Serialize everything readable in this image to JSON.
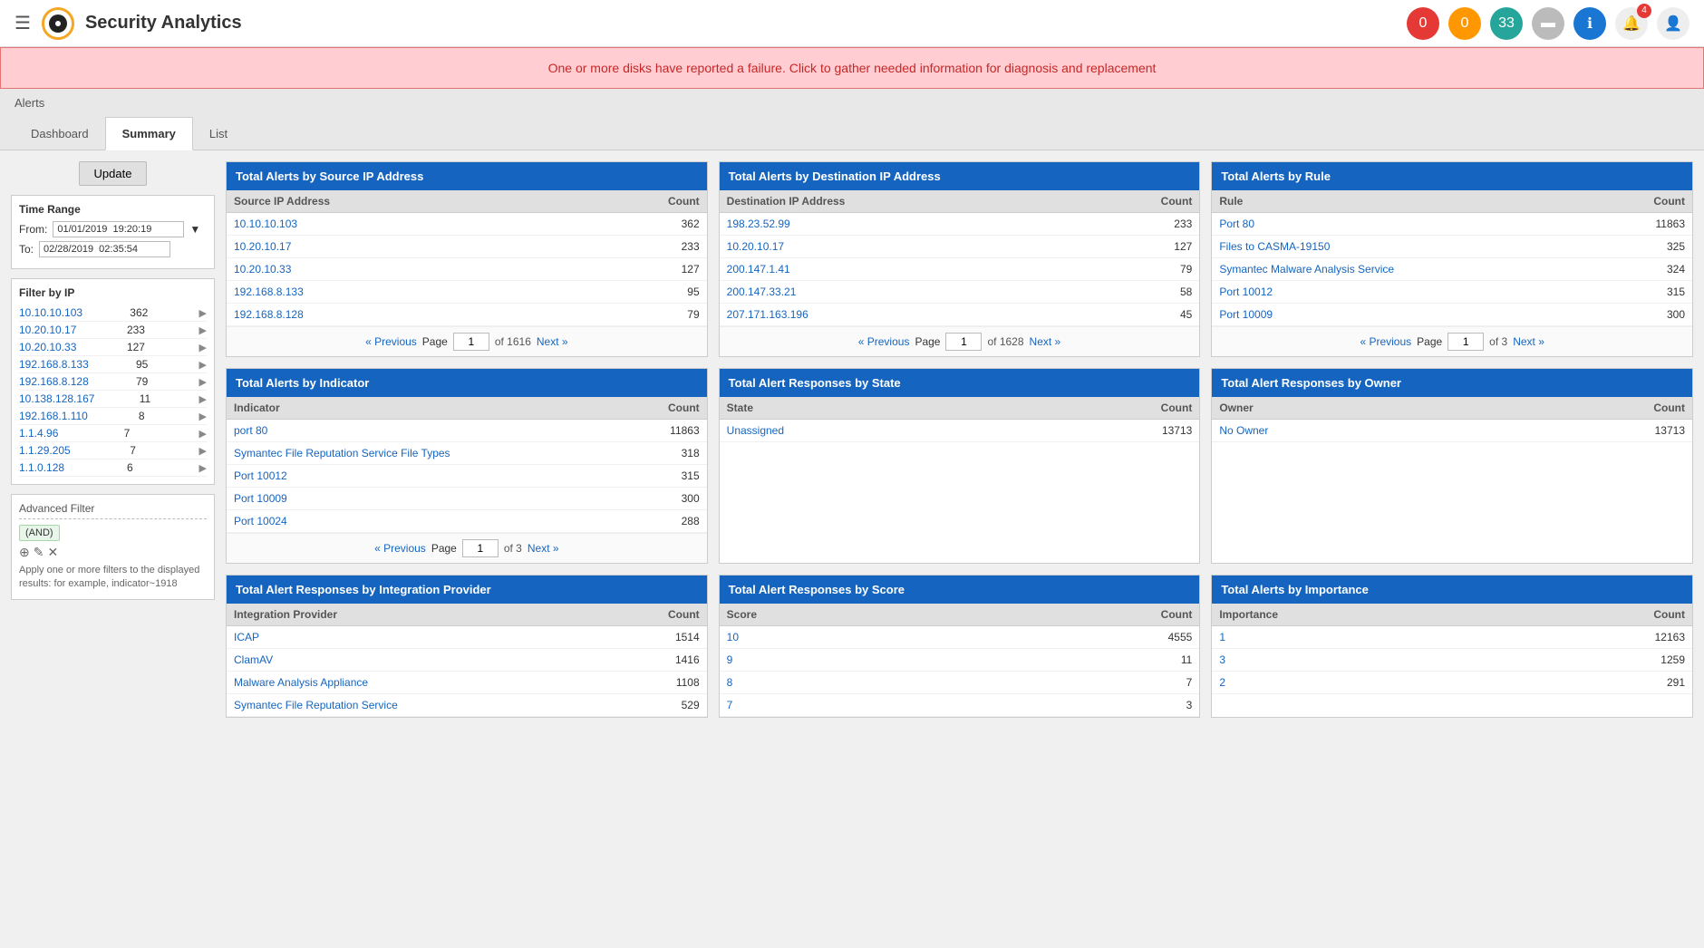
{
  "header": {
    "menu_icon": "☰",
    "logo_text": "●",
    "title": "Security Analytics",
    "badges": [
      {
        "id": "badge-0",
        "count": "0",
        "color": "red"
      },
      {
        "id": "badge-1",
        "count": "0",
        "color": "orange"
      },
      {
        "id": "badge-33",
        "count": "33",
        "color": "teal"
      }
    ],
    "notification_count": "4"
  },
  "alert_banner": "One or more disks have reported a failure. Click to gather needed information for diagnosis and replacement",
  "breadcrumb": "Alerts",
  "tabs": [
    {
      "label": "Dashboard",
      "active": false
    },
    {
      "label": "Summary",
      "active": true
    },
    {
      "label": "List",
      "active": false
    }
  ],
  "sidebar": {
    "update_btn": "Update",
    "time_range_title": "Time Range",
    "from_label": "From:",
    "from_value": "01/01/2019  19:20:19",
    "to_label": "To:",
    "to_value": "02/28/2019  02:35:54",
    "filter_by_ip_title": "Filter by IP",
    "ip_filters": [
      {
        "ip": "10.10.10.103",
        "count": "362"
      },
      {
        "ip": "10.20.10.17",
        "count": "233"
      },
      {
        "ip": "10.20.10.33",
        "count": "127"
      },
      {
        "ip": "192.168.8.133",
        "count": "95"
      },
      {
        "ip": "192.168.8.128",
        "count": "79"
      },
      {
        "ip": "10.138.128.167",
        "count": "11"
      },
      {
        "ip": "192.168.1.110",
        "count": "8"
      },
      {
        "ip": "1.1.4.96",
        "count": "7"
      },
      {
        "ip": "1.1.29.205",
        "count": "7"
      },
      {
        "ip": "1.1.0.128",
        "count": "6"
      }
    ],
    "advanced_filter_title": "Advanced Filter",
    "and_tag": "(AND)",
    "filter_help": "Apply one or more filters to the displayed results: for example, indicator~1918"
  },
  "cards": {
    "source_ip": {
      "title": "Total Alerts by Source IP Address",
      "col1": "Source IP Address",
      "col2": "Count",
      "rows": [
        {
          "label": "10.10.10.103",
          "count": "362"
        },
        {
          "label": "10.20.10.17",
          "count": "233"
        },
        {
          "label": "10.20.10.33",
          "count": "127"
        },
        {
          "label": "192.168.8.133",
          "count": "95"
        },
        {
          "label": "192.168.8.128",
          "count": "79"
        }
      ],
      "prev": "« Previous",
      "page": "1",
      "of": "of 1616",
      "next": "Next »"
    },
    "dest_ip": {
      "title": "Total Alerts by Destination IP Address",
      "col1": "Destination IP Address",
      "col2": "Count",
      "rows": [
        {
          "label": "198.23.52.99",
          "count": "233"
        },
        {
          "label": "10.20.10.17",
          "count": "127"
        },
        {
          "label": "200.147.1.41",
          "count": "79"
        },
        {
          "label": "200.147.33.21",
          "count": "58"
        },
        {
          "label": "207.171.163.196",
          "count": "45"
        }
      ],
      "prev": "« Previous",
      "page": "1",
      "of": "of 1628",
      "next": "Next »"
    },
    "rule": {
      "title": "Total Alerts by Rule",
      "col1": "Rule",
      "col2": "Count",
      "rows": [
        {
          "label": "Port 80",
          "count": "11863"
        },
        {
          "label": "Files to CASMA-19150",
          "count": "325"
        },
        {
          "label": "Symantec Malware Analysis Service",
          "count": "324"
        },
        {
          "label": "Port 10012",
          "count": "315"
        },
        {
          "label": "Port 10009",
          "count": "300"
        }
      ],
      "prev": "« Previous",
      "page": "1",
      "of": "of 3",
      "next": "Next »"
    },
    "indicator": {
      "title": "Total Alerts by Indicator",
      "col1": "Indicator",
      "col2": "Count",
      "rows": [
        {
          "label": "port 80",
          "count": "11863"
        },
        {
          "label": "Symantec File Reputation Service File Types",
          "count": "318"
        },
        {
          "label": "Port 10012",
          "count": "315"
        },
        {
          "label": "Port 10009",
          "count": "300"
        },
        {
          "label": "Port 10024",
          "count": "288"
        }
      ],
      "prev": "« Previous",
      "page": "1",
      "of": "of 3",
      "next": "Next »"
    },
    "response_state": {
      "title": "Total Alert Responses by State",
      "col1": "State",
      "col2": "Count",
      "rows": [
        {
          "label": "Unassigned",
          "count": "13713"
        }
      ]
    },
    "response_owner": {
      "title": "Total Alert Responses by Owner",
      "col1": "Owner",
      "col2": "Count",
      "rows": [
        {
          "label": "No Owner",
          "count": "13713"
        }
      ]
    },
    "integration_provider": {
      "title": "Total Alert Responses by Integration Provider",
      "col1": "Integration Provider",
      "col2": "Count",
      "rows": [
        {
          "label": "ICAP",
          "count": "1514"
        },
        {
          "label": "ClamAV",
          "count": "1416"
        },
        {
          "label": "Malware Analysis Appliance",
          "count": "1108"
        },
        {
          "label": "Symantec File Reputation Service",
          "count": "529"
        }
      ]
    },
    "response_score": {
      "title": "Total Alert Responses by Score",
      "col1": "Score",
      "col2": "Count",
      "rows": [
        {
          "label": "10",
          "count": "4555"
        },
        {
          "label": "9",
          "count": "11"
        },
        {
          "label": "8",
          "count": "7"
        },
        {
          "label": "7",
          "count": "3"
        }
      ]
    },
    "importance": {
      "title": "Total Alerts by Importance",
      "col1": "Importance",
      "col2": "Count",
      "rows": [
        {
          "label": "1",
          "count": "12163"
        },
        {
          "label": "3",
          "count": "1259"
        },
        {
          "label": "2",
          "count": "291"
        }
      ]
    }
  }
}
